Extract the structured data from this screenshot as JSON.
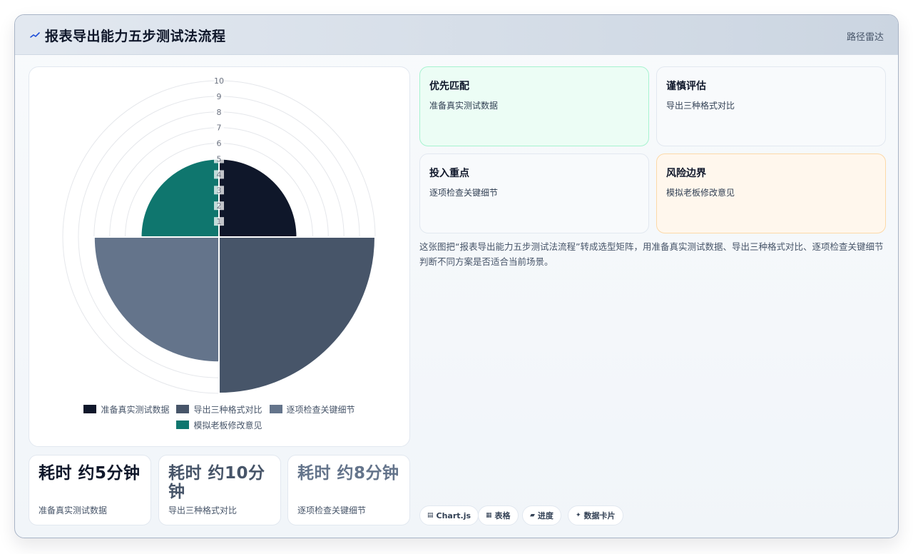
{
  "header": {
    "title": "报表导出能力五步测试法流程",
    "right_label": "路径雷达",
    "icon": "pulse-icon"
  },
  "chart_data": {
    "type": "polarArea",
    "r_ticks": [
      "1",
      "2",
      "3",
      "4",
      "5",
      "6",
      "7",
      "8",
      "9",
      "10"
    ],
    "r_max": 10,
    "categories": [
      "准备真实测试数据",
      "导出三种格式对比",
      "逐项检查关键细节",
      "模拟老板修改意见"
    ],
    "values": [
      5,
      10,
      8,
      5
    ],
    "colors": [
      "#0f172a",
      "#475569",
      "#64748b",
      "#0f766e"
    ],
    "legend_position": "bottom",
    "grid": true
  },
  "stats": [
    {
      "value": "耗时 约5分钟",
      "label": "准备真实测试数据",
      "color": "#0f172a"
    },
    {
      "value": "耗时 约10分钟",
      "label": "导出三种格式对比",
      "color": "#475569"
    },
    {
      "value": "耗时 约8分钟",
      "label": "逐项检查关键细节",
      "color": "#64748b"
    }
  ],
  "tiles": [
    {
      "title": "优先匹配",
      "body": "准备真实测试数据",
      "bg": "#ecfdf5",
      "border": "#a7f3d0"
    },
    {
      "title": "谨慎评估",
      "body": "导出三种格式对比",
      "bg": "#f8fafc",
      "border": "#e2e8f0"
    },
    {
      "title": "投入重点",
      "body": "逐项检查关键细节",
      "bg": "#f8fafc",
      "border": "#e2e8f0"
    },
    {
      "title": "风险边界",
      "body": "模拟老板修改意见",
      "bg": "#fff7ed",
      "border": "#fcd9a8"
    }
  ],
  "description": "这张图把“报表导出能力五步测试法流程”转成选型矩阵，用准备真实测试数据、导出三种格式对比、逐项检查关键细节判断不同方案是否适合当前场景。",
  "chips": [
    {
      "icon": "▤",
      "label": "Chart.js"
    },
    {
      "icon": "▦",
      "label": "表格"
    },
    {
      "icon": "▰",
      "label": "进度"
    },
    {
      "icon": "✦",
      "label": "数据卡片"
    }
  ]
}
